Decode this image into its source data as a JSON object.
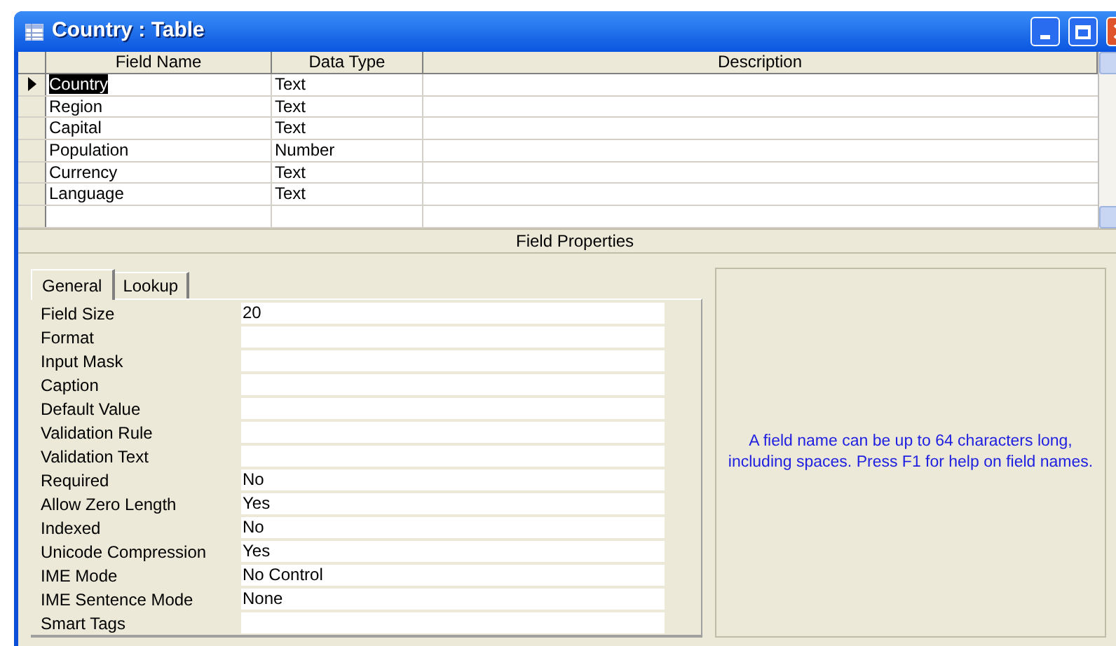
{
  "window": {
    "title": "Country : Table"
  },
  "table": {
    "columns": [
      "Field Name",
      "Data Type",
      "Description"
    ],
    "rows": [
      {
        "field_name": "Country",
        "data_type": "Text",
        "selected": true
      },
      {
        "field_name": "Region",
        "data_type": "Text",
        "selected": false
      },
      {
        "field_name": "Capital",
        "data_type": "Text",
        "selected": false
      },
      {
        "field_name": "Population",
        "data_type": "Number",
        "selected": false
      },
      {
        "field_name": "Currency",
        "data_type": "Text",
        "selected": false
      },
      {
        "field_name": "Language",
        "data_type": "Text",
        "selected": false
      }
    ]
  },
  "field_properties": {
    "title": "Field Properties",
    "tabs": [
      {
        "label": "General",
        "selected": true
      },
      {
        "label": "Lookup",
        "selected": false
      }
    ],
    "properties": [
      {
        "label": "Field Size",
        "value": "20"
      },
      {
        "label": "Format"
      },
      {
        "label": "Input Mask"
      },
      {
        "label": "Caption"
      },
      {
        "label": "Default Value"
      },
      {
        "label": "Validation Rule"
      },
      {
        "label": "Validation Text"
      },
      {
        "label": "Required",
        "value": "No"
      },
      {
        "label": "Allow Zero Length",
        "value": "Yes"
      },
      {
        "label": "Indexed",
        "value": "No"
      },
      {
        "label": "Unicode Compression",
        "value": "Yes"
      },
      {
        "label": "IME Mode",
        "value": "No Control"
      },
      {
        "label": "IME Sentence Mode",
        "value": "None"
      },
      {
        "label": "Smart Tags"
      }
    ],
    "help_text": "A field name can be up to 64 characters long, including spaces.  Press F1 for help on field names."
  }
}
